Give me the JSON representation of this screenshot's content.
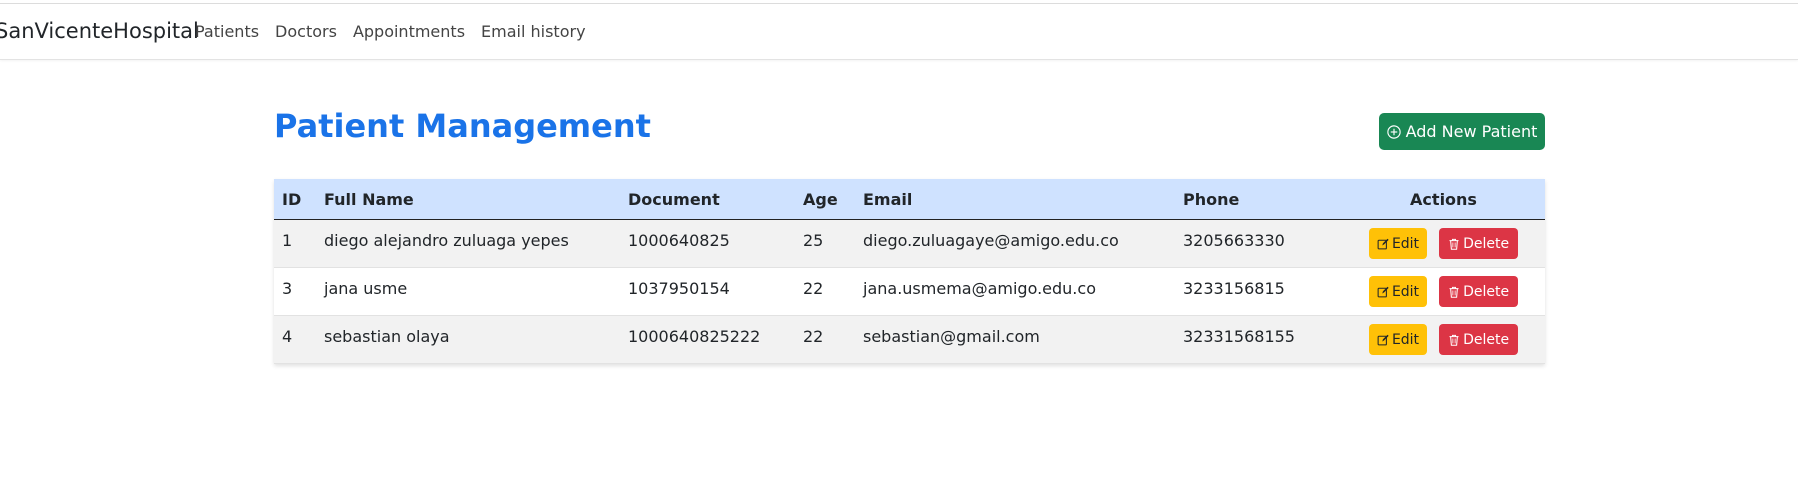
{
  "navbar": {
    "brand": "SanVicenteHospital",
    "links": [
      "Patients",
      "Doctors",
      "Appointments",
      "Email history"
    ]
  },
  "page": {
    "title": "Patient Management",
    "add_button_label": "Add New Patient",
    "add_button_icon": "plus-circle-icon"
  },
  "table": {
    "headers": [
      "ID",
      "Full Name",
      "Document",
      "Age",
      "Email",
      "Phone",
      "Actions"
    ],
    "rows": [
      {
        "id": "1",
        "full_name": "diego alejandro zuluaga yepes",
        "document": "1000640825",
        "age": "25",
        "email": "diego.zuluagaye@amigo.edu.co",
        "phone": "3205663330"
      },
      {
        "id": "3",
        "full_name": "jana usme",
        "document": "1037950154",
        "age": "22",
        "email": "jana.usmema@amigo.edu.co",
        "phone": "3233156815"
      },
      {
        "id": "4",
        "full_name": "sebastian olaya",
        "document": "1000640825222",
        "age": "22",
        "email": "sebastian@gmail.com",
        "phone": "32331568155"
      }
    ],
    "edit_label": "Edit",
    "delete_label": "Delete",
    "edit_icon": "pencil-square-icon",
    "delete_icon": "trash-icon"
  },
  "colors": {
    "title": "#1a73e8",
    "add_button": "#198754",
    "header_row": "#cfe2ff",
    "edit_button": "#ffc107",
    "delete_button": "#dc3545"
  }
}
